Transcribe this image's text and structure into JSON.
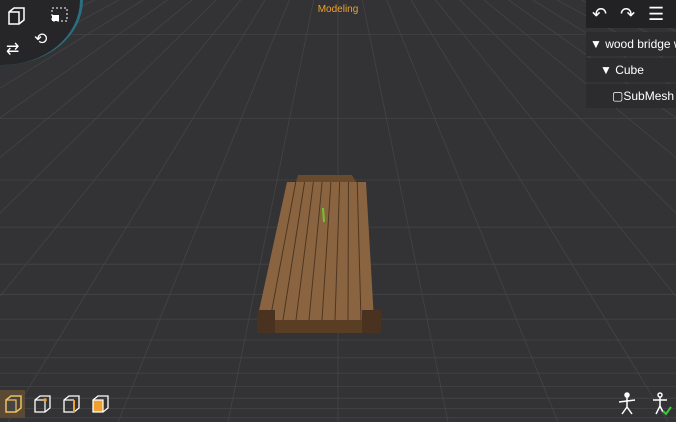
{
  "header": {
    "mode": "Modeling"
  },
  "toolbar": {
    "undo_icon": "undo-icon",
    "redo_icon": "redo-icon",
    "menu_icon": "hamburger-menu-icon"
  },
  "hierarchy": {
    "items": [
      {
        "label": "wood bridge wood",
        "depth": 0,
        "expanded": true
      },
      {
        "label": "Cube",
        "depth": 1,
        "expanded": true
      },
      {
        "label": "SubMesh",
        "depth": 2
      }
    ]
  },
  "radial_menu": {
    "icons": [
      "cube-icon",
      "selection-rect-icon",
      "swap-arrows-icon",
      "rotate-icon"
    ]
  },
  "bottom_tools": [
    "object-mode-icon",
    "vertex-mode-icon",
    "edge-mode-icon",
    "face-mode-icon"
  ],
  "right_tools": [
    "rig-icon",
    "pose-check-icon"
  ],
  "colors": {
    "accent": "#f0a030",
    "background": "#333335",
    "wood": "#8a6440"
  }
}
